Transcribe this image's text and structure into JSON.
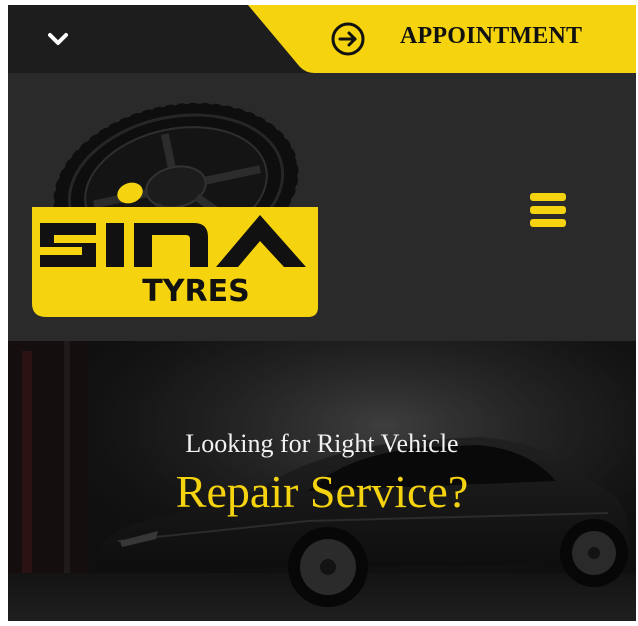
{
  "topbar": {
    "toggle_icon": "chevron-down-icon",
    "appointment_icon": "arrow-right-circle-icon",
    "appointment_label": "APPOINTMENT"
  },
  "header": {
    "logo": {
      "brand": "SINA",
      "tagline": "TYRES"
    },
    "menu_icon": "hamburger-menu-icon"
  },
  "hero": {
    "subtitle": "Looking for Right Vehicle",
    "title": "Repair Service?"
  },
  "colors": {
    "accent": "#f5d40f",
    "dark": "#1d1d1d",
    "header_bg": "#2a2a2a"
  }
}
